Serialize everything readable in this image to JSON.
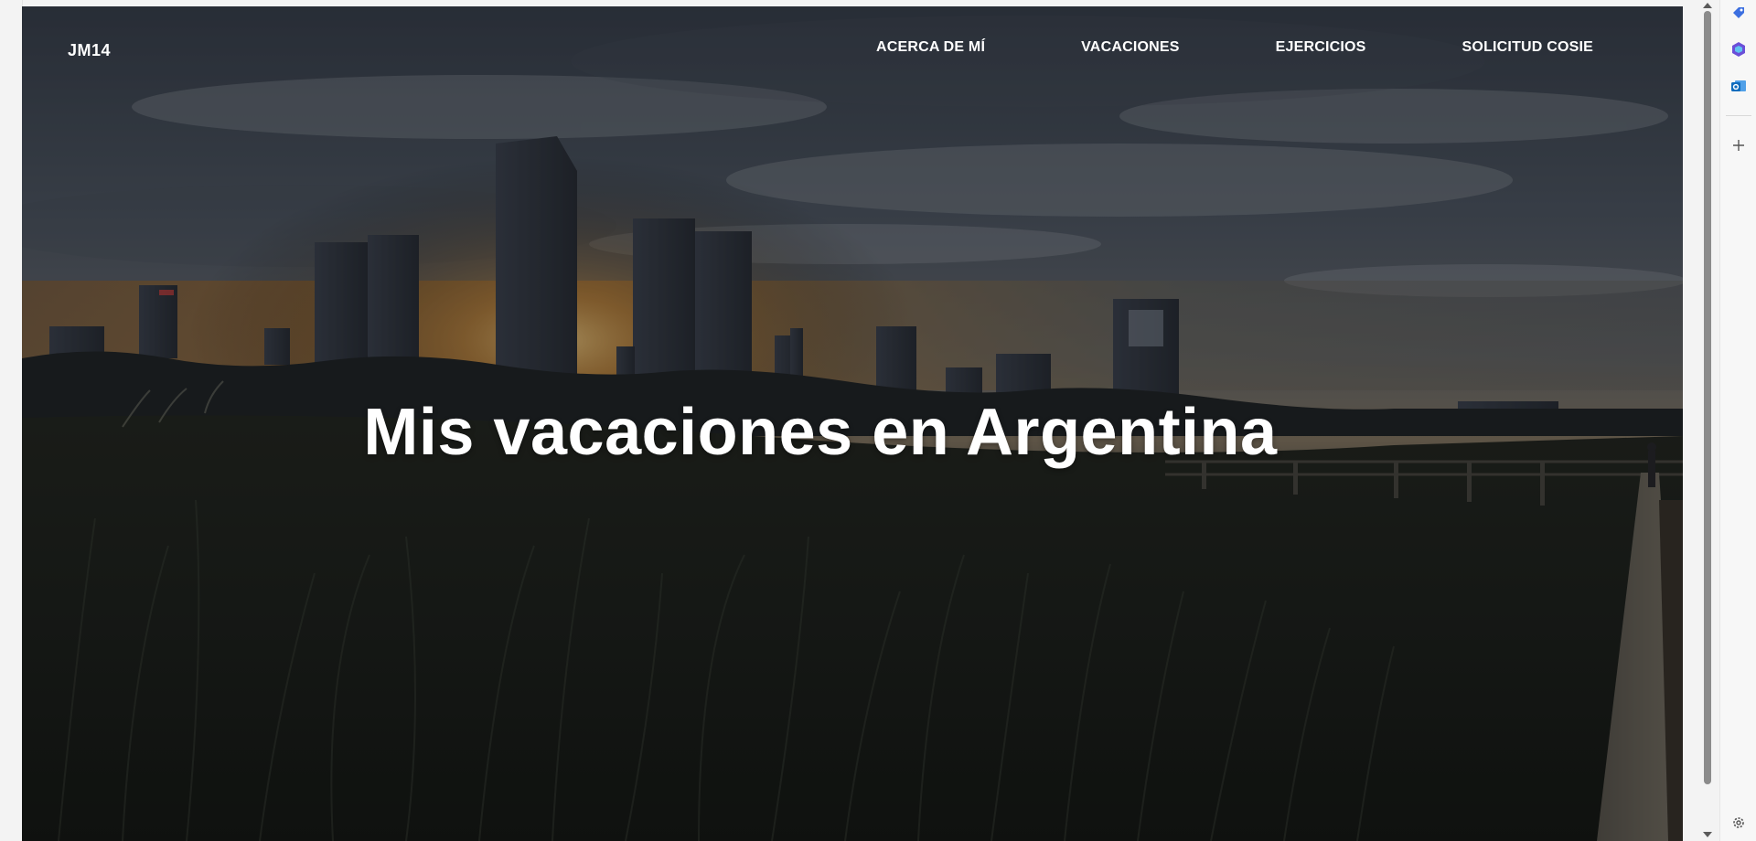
{
  "site": {
    "brand": "JM14",
    "nav": [
      {
        "label": "ACERCA DE MÍ"
      },
      {
        "label": "VACACIONES"
      },
      {
        "label": "EJERCICIOS"
      },
      {
        "label": "SOLICITUD COSIE"
      }
    ],
    "hero_title": "Mis vacaciones en Argentina"
  },
  "browser": {
    "sidebar_icons": [
      "tag-icon",
      "copilot-icon",
      "outlook-icon",
      "add-icon",
      "settings-icon"
    ]
  }
}
